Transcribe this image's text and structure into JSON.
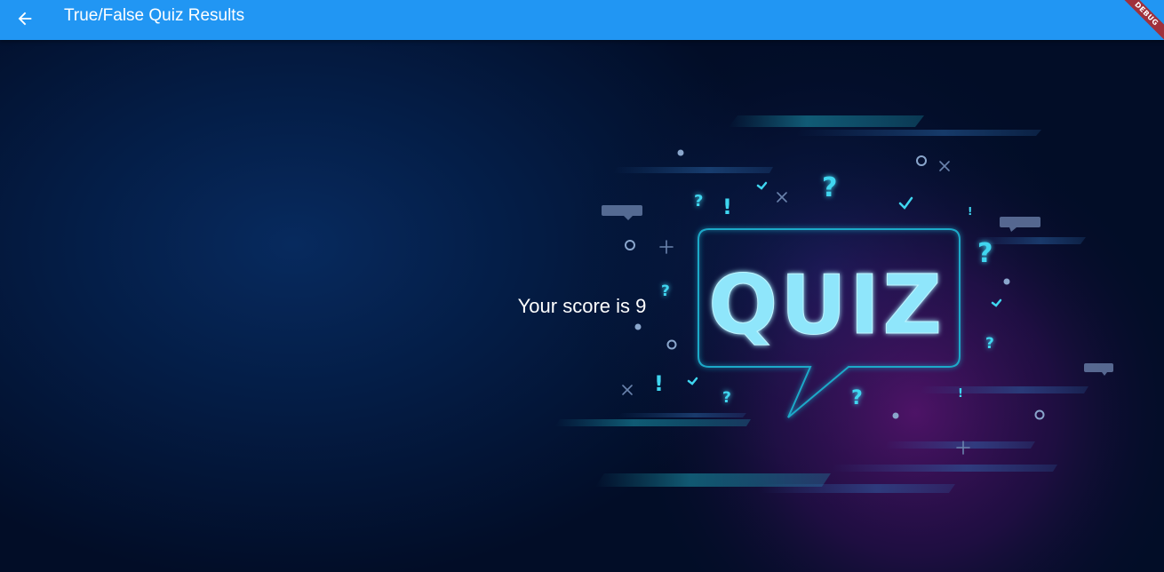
{
  "appbar": {
    "title": "True/False Quiz Results",
    "back_icon": "arrow-back-icon",
    "color": "#2196f3"
  },
  "debug_banner": {
    "label": "DEBUG"
  },
  "content": {
    "score_text": "Your score is 9",
    "illustration": {
      "word": "QUIZ"
    }
  }
}
